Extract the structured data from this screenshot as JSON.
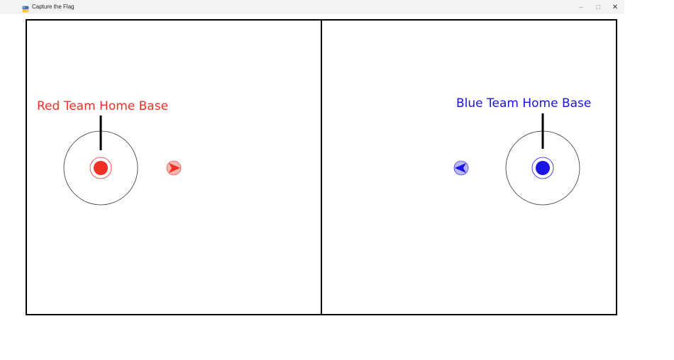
{
  "window": {
    "title": "Capture the Flag",
    "minimize_glyph": "–",
    "maximize_glyph": "□",
    "close_glyph": "✕",
    "icon": "python-icon"
  },
  "field": {
    "red_base": {
      "label": "Red Team Home Base",
      "color": "#ee3124"
    },
    "blue_base": {
      "label": "Blue Team Home Base",
      "color": "#1a14e6"
    },
    "red_player": {
      "color": "#ee3124",
      "facing": "right"
    },
    "blue_player": {
      "color": "#1a14e6",
      "facing": "left"
    }
  }
}
